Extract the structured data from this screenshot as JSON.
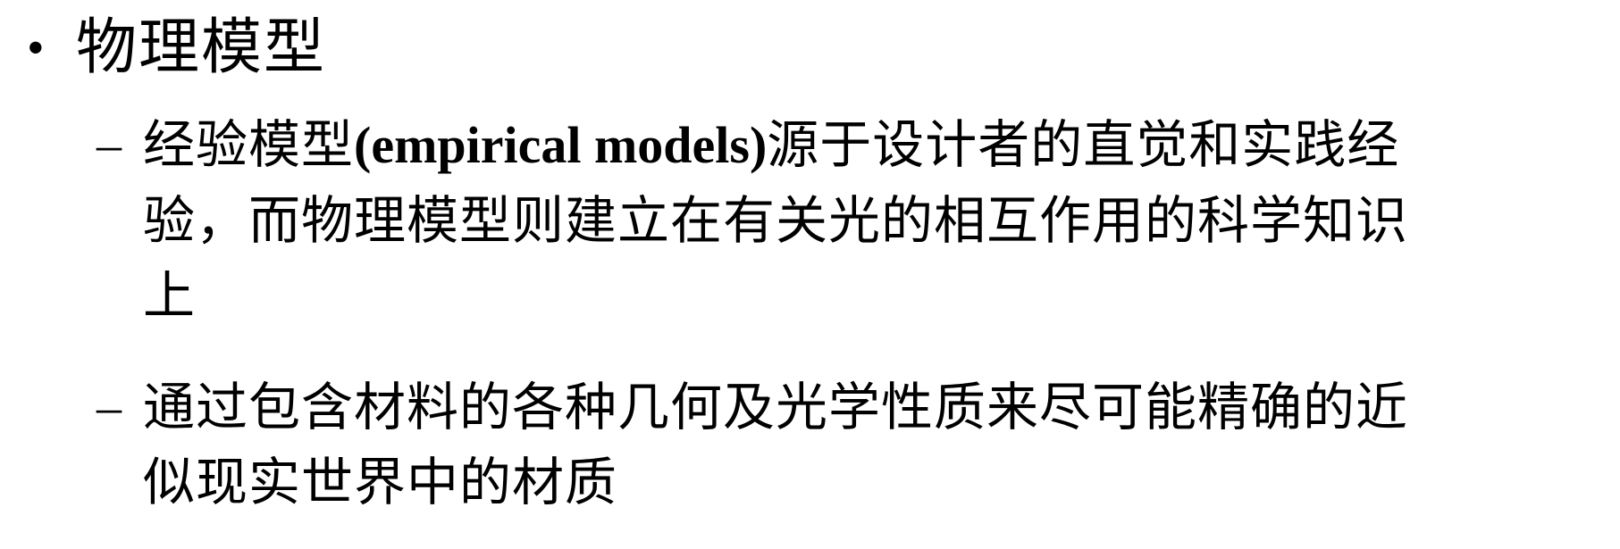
{
  "heading": {
    "bullet": "•",
    "text": "物理模型"
  },
  "items": [
    {
      "marker": "–",
      "text_before": "经验模型",
      "text_latin": "(empirical models)",
      "text_after": "源于设计者的直觉和实践经\n验，而物理模型则建立在有关光的相互作用的科学知识\n上"
    },
    {
      "marker": "–",
      "text": "通过包含材料的各种几何及光学性质来尽可能精确的近\n似现实世界中的材质"
    }
  ]
}
